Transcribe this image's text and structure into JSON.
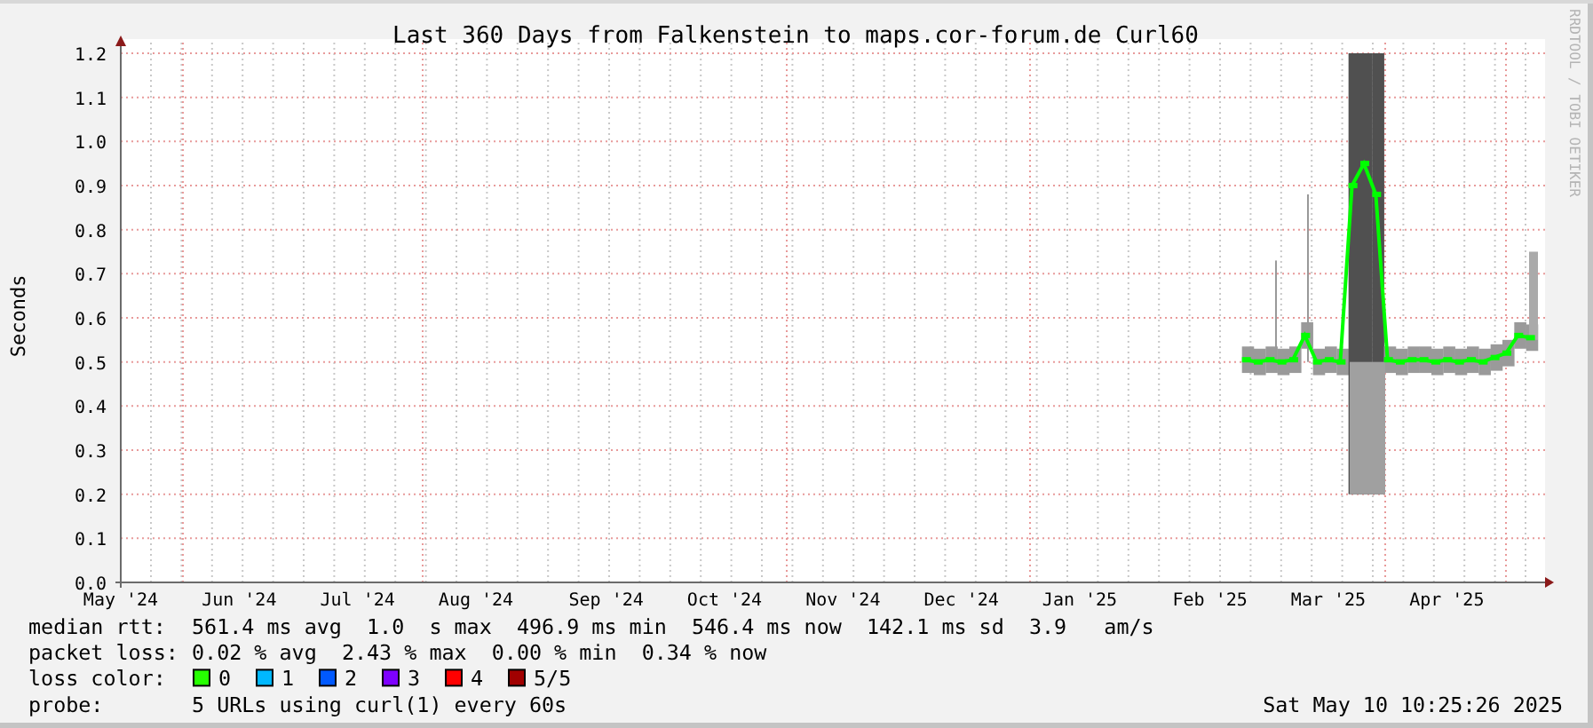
{
  "graph": {
    "title": "Last 360 Days from Falkenstein to maps.cor-forum.de Curl60",
    "side_text": "RRDTOOL / TOBI OETIKER",
    "chart_data": {
      "type": "line",
      "grid": true,
      "ylabel": "Seconds",
      "ylim": [
        0,
        1.2
      ],
      "categories": [
        "May '24",
        null,
        null,
        null,
        null,
        null,
        null,
        null,
        null,
        null,
        "Jun '24",
        null,
        null,
        null,
        null,
        null,
        null,
        null,
        null,
        null,
        "Jul '24",
        null,
        null,
        null,
        null,
        null,
        null,
        null,
        null,
        null,
        "Aug '24",
        null,
        null,
        null,
        null,
        null,
        null,
        null,
        null,
        null,
        null,
        "Sep '24",
        null,
        null,
        null,
        null,
        null,
        null,
        null,
        null,
        null,
        "Oct '24",
        null,
        null,
        null,
        null,
        null,
        null,
        null,
        null,
        null,
        "Nov '24",
        null,
        null,
        null,
        null,
        null,
        null,
        null,
        null,
        null,
        "Dec '24",
        null,
        null,
        null,
        null,
        null,
        null,
        null,
        null,
        null,
        "Jan '25",
        null,
        null,
        null,
        null,
        null,
        null,
        null,
        null,
        null,
        null,
        "Feb '25",
        null,
        null,
        null,
        null,
        null,
        null,
        null,
        null,
        null,
        "Mar '25",
        null,
        null,
        null,
        null,
        null,
        null,
        null,
        null,
        null,
        "Apr '25",
        null,
        null,
        null,
        null,
        null,
        null,
        null
      ],
      "yticks": [
        {
          "value": 0,
          "label": "0.0"
        },
        {
          "value": 0.1,
          "label": "0.1"
        },
        {
          "value": 0.2,
          "label": "0.2"
        },
        {
          "value": 0.3,
          "label": "0.3"
        },
        {
          "value": 0.4,
          "label": "0.4"
        },
        {
          "value": 0.5,
          "label": "0.5"
        },
        {
          "value": 0.6,
          "label": "0.6"
        },
        {
          "value": 0.7,
          "label": "0.7"
        },
        {
          "value": 0.8,
          "label": "0.8"
        },
        {
          "value": 0.9,
          "label": "0.9"
        },
        {
          "value": 1.0,
          "label": "1.0"
        },
        {
          "value": 1.1,
          "label": "1.1"
        },
        {
          "value": 1.2,
          "label": "1.2"
        }
      ],
      "series": [
        {
          "color": "#00ff00",
          "marker": "square",
          "values": [
            null,
            null,
            null,
            null,
            null,
            null,
            null,
            null,
            null,
            null,
            null,
            null,
            null,
            null,
            null,
            null,
            null,
            null,
            null,
            null,
            null,
            null,
            null,
            null,
            null,
            null,
            null,
            null,
            null,
            null,
            null,
            null,
            null,
            null,
            null,
            null,
            null,
            null,
            null,
            null,
            null,
            null,
            null,
            null,
            null,
            null,
            null,
            null,
            null,
            null,
            null,
            null,
            null,
            null,
            null,
            null,
            null,
            null,
            null,
            null,
            null,
            null,
            null,
            null,
            null,
            null,
            null,
            null,
            null,
            null,
            null,
            null,
            null,
            null,
            null,
            null,
            null,
            null,
            null,
            null,
            null,
            null,
            null,
            null,
            null,
            null,
            null,
            null,
            null,
            null,
            null,
            null,
            null,
            null,
            null,
            0.505,
            0.5,
            0.505,
            0.5,
            0.505,
            0.56,
            0.5,
            0.505,
            0.5,
            0.9,
            0.95,
            0.88,
            0.505,
            0.5,
            0.505,
            0.505,
            0.5,
            0.505,
            0.5,
            0.505,
            0.5,
            0.51,
            0.52,
            0.56,
            0.555
          ]
        }
      ]
    }
  },
  "legend": {
    "lines": [
      {
        "kind": "text",
        "label": "median rtt:",
        "text": "561.4 ms avg  1.0  s max  496.9 ms min  546.4 ms now  142.1 ms sd  3.9   am/s"
      },
      {
        "kind": "text",
        "label": "packet loss:",
        "text": "0.02 % avg  2.43 % max  0.00 % min  0.34 % now"
      },
      {
        "kind": "swatches",
        "label": "loss color:",
        "items": [
          {
            "label": "0",
            "color": "#26ff00"
          },
          {
            "label": "1",
            "color": "#00b8ff"
          },
          {
            "label": "2",
            "color": "#0059ff"
          },
          {
            "label": "3",
            "color": "#7e00ff"
          },
          {
            "label": "4",
            "color": "#ff0000"
          },
          {
            "label": "5/5",
            "color": "#a10000"
          }
        ]
      },
      {
        "kind": "text",
        "label": "probe:",
        "text": "5 URLs using curl(1) every 60s"
      }
    ],
    "timestamp": "Sat May 10 10:25:26 2025"
  }
}
